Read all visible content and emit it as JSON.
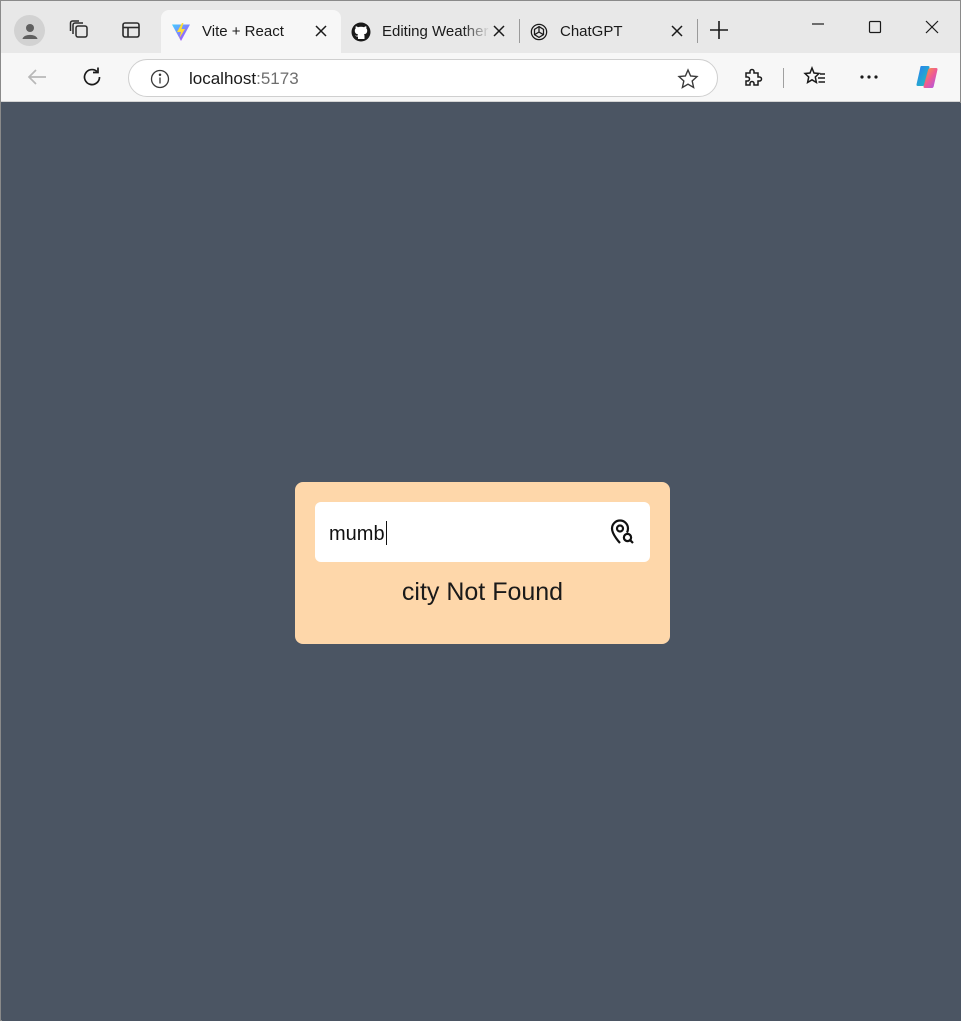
{
  "browser": {
    "tabs": [
      {
        "title": "Vite + React",
        "favicon": "vite-icon",
        "active": true
      },
      {
        "title": "Editing Weather",
        "favicon": "github-icon",
        "active": false
      },
      {
        "title": "ChatGPT",
        "favicon": "chatgpt-icon",
        "active": false
      }
    ],
    "address": {
      "host": "localhost",
      "port": ":5173"
    }
  },
  "app": {
    "search": {
      "value": "mumb",
      "icon": "location-search-icon"
    },
    "message": "city Not Found"
  },
  "colors": {
    "page_background": "#4b5563",
    "card_background": "#fed7aa",
    "input_background": "#ffffff"
  }
}
